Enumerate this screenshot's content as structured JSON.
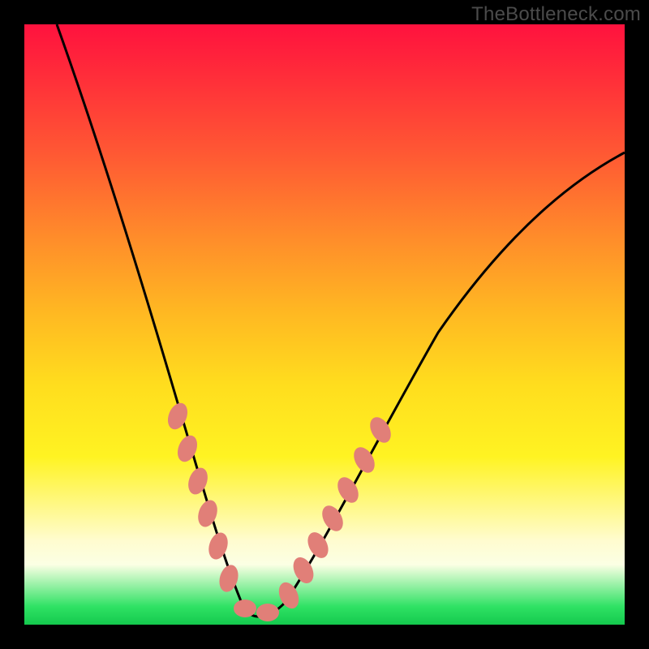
{
  "watermark": "TheBottleneck.com",
  "chart_data": {
    "type": "line",
    "title": "",
    "xlabel": "",
    "ylabel": "",
    "xlim": [
      0,
      100
    ],
    "ylim": [
      0,
      100
    ],
    "x": [
      0,
      3,
      6,
      9,
      12,
      15,
      18,
      21,
      24,
      27,
      30,
      33,
      36,
      40,
      44,
      48,
      52,
      56,
      60,
      66,
      72,
      78,
      84,
      90,
      96,
      100
    ],
    "values": [
      100,
      90,
      80,
      70,
      60,
      50,
      41,
      33,
      25,
      18,
      11,
      6,
      2,
      0,
      2,
      7,
      13,
      20,
      27,
      36,
      44,
      52,
      59,
      65,
      70,
      73
    ],
    "legend": [],
    "gradient_colors": [
      "#ff123e",
      "#ff5a33",
      "#ffb822",
      "#fff322",
      "#fffccf",
      "#14c94e"
    ],
    "marker_clusters": [
      {
        "side": "left",
        "x_range": [
          24,
          34
        ],
        "y_range": [
          2,
          28
        ]
      },
      {
        "side": "right",
        "x_range": [
          40,
          56
        ],
        "y_range": [
          0,
          26
        ]
      }
    ],
    "marker_color": "#e17f78"
  }
}
